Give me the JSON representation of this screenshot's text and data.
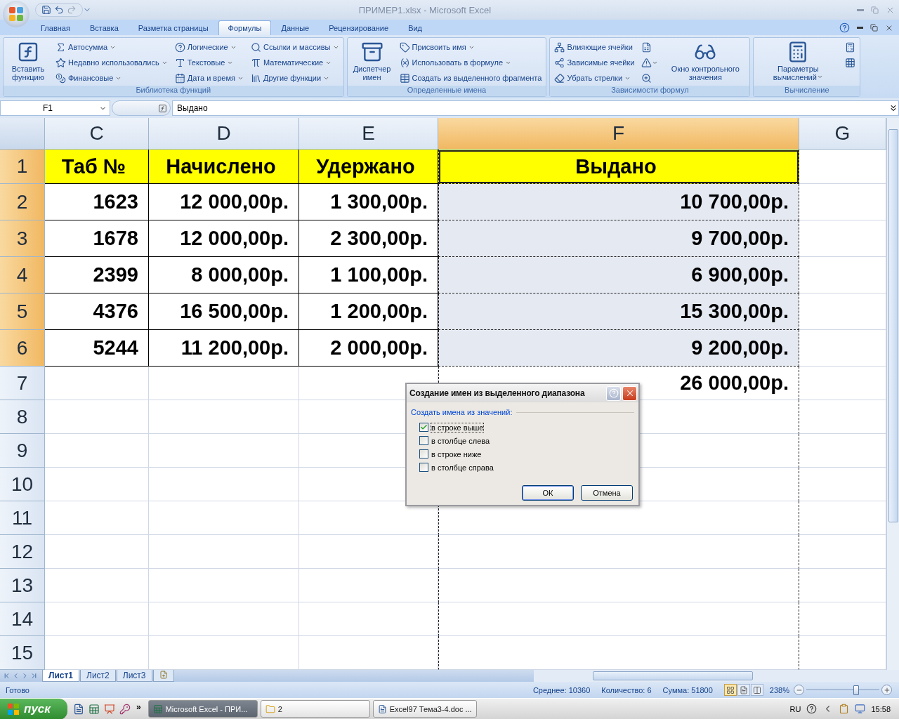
{
  "title_bar": {
    "title": "ПРИМЕР1.xlsx - Microsoft Excel"
  },
  "ribbon_tabs": [
    {
      "label": "Главная",
      "selected": false
    },
    {
      "label": "Вставка",
      "selected": false
    },
    {
      "label": "Разметка страницы",
      "selected": false
    },
    {
      "label": "Формулы",
      "selected": true
    },
    {
      "label": "Данные",
      "selected": false
    },
    {
      "label": "Рецензирование",
      "selected": false
    },
    {
      "label": "Вид",
      "selected": false
    }
  ],
  "ribbon_groups": [
    {
      "label": "Библиотека функций",
      "columns": [
        [
          {
            "kind": "large",
            "label": "Вставить функцию",
            "dropdown": false
          }
        ],
        [
          {
            "kind": "small",
            "label": "Автосумма",
            "dropdown": true
          },
          {
            "kind": "small",
            "label": "Недавно использовались",
            "dropdown": true
          },
          {
            "kind": "small",
            "label": "Финансовые",
            "dropdown": true
          }
        ],
        [
          {
            "kind": "small",
            "label": "Логические",
            "dropdown": true
          },
          {
            "kind": "small",
            "label": "Текстовые",
            "dropdown": true
          },
          {
            "kind": "small",
            "label": "Дата и время",
            "dropdown": true
          }
        ],
        [
          {
            "kind": "small",
            "label": "Ссылки и массивы",
            "dropdown": true
          },
          {
            "kind": "small",
            "label": "Математические",
            "dropdown": true
          },
          {
            "kind": "small",
            "label": "Другие функции",
            "dropdown": true
          }
        ]
      ]
    },
    {
      "label": "Определенные имена",
      "columns": [
        [
          {
            "kind": "large",
            "label": "Диспетчер имен",
            "dropdown": false
          }
        ],
        [
          {
            "kind": "small",
            "label": "Присвоить имя",
            "dropdown": true
          },
          {
            "kind": "small",
            "label": "Использовать в формуле",
            "dropdown": true
          },
          {
            "kind": "small",
            "label": "Создать из выделенного фрагмента",
            "dropdown": false
          }
        ]
      ]
    },
    {
      "label": "Зависимости формул",
      "columns": [
        [
          {
            "kind": "small",
            "label": "Влияющие ячейки",
            "dropdown": false
          },
          {
            "kind": "small",
            "label": "Зависимые ячейки",
            "dropdown": false
          },
          {
            "kind": "small",
            "label": "Убрать стрелки",
            "dropdown": true
          }
        ],
        [
          {
            "kind": "icon",
            "dropdown": false
          },
          {
            "kind": "icon",
            "dropdown": true
          },
          {
            "kind": "icon",
            "dropdown": false
          }
        ],
        [
          {
            "kind": "large",
            "label": "Окно контрольного значения",
            "dropdown": false
          }
        ]
      ]
    },
    {
      "label": "Вычисление",
      "columns": [
        [
          {
            "kind": "large",
            "label": "Параметры вычислений",
            "dropdown": true
          }
        ],
        [
          {
            "kind": "icon",
            "dropdown": false
          },
          {
            "kind": "icon",
            "dropdown": false
          }
        ]
      ]
    }
  ],
  "formula_bar": {
    "name_box": "F1",
    "formula": "Выдано"
  },
  "columns": [
    {
      "label": "C",
      "selected": false
    },
    {
      "label": "D",
      "selected": false
    },
    {
      "label": "E",
      "selected": false
    },
    {
      "label": "F",
      "selected": true
    },
    {
      "label": "G",
      "selected": false
    }
  ],
  "rows": [
    {
      "header": "1",
      "selected": true,
      "kind": "header",
      "cells": [
        {
          "text": "Таб №",
          "selected": false
        },
        {
          "text": "Начислено",
          "selected": false
        },
        {
          "text": "Удержано",
          "selected": false
        },
        {
          "text": "Выдано",
          "selected": true
        },
        null
      ]
    },
    {
      "header": "2",
      "selected": true,
      "kind": "data",
      "cells": [
        {
          "text": "1623",
          "selected": false
        },
        {
          "text": "12 000,00р.",
          "selected": false
        },
        {
          "text": "1 300,00р.",
          "selected": false
        },
        {
          "text": "10 700,00р.",
          "selected": true
        },
        null
      ]
    },
    {
      "header": "3",
      "selected": true,
      "kind": "data",
      "cells": [
        {
          "text": "1678",
          "selected": false
        },
        {
          "text": "12 000,00р.",
          "selected": false
        },
        {
          "text": "2 300,00р.",
          "selected": false
        },
        {
          "text": "9 700,00р.",
          "selected": true
        },
        null
      ]
    },
    {
      "header": "4",
      "selected": true,
      "kind": "data",
      "cells": [
        {
          "text": "2399",
          "selected": false
        },
        {
          "text": "8 000,00р.",
          "selected": false
        },
        {
          "text": "1 100,00р.",
          "selected": false
        },
        {
          "text": "6 900,00р.",
          "selected": true
        },
        null
      ]
    },
    {
      "header": "5",
      "selected": true,
      "kind": "data",
      "cells": [
        {
          "text": "4376",
          "selected": false
        },
        {
          "text": "16 500,00р.",
          "selected": false
        },
        {
          "text": "1 200,00р.",
          "selected": false
        },
        {
          "text": "15 300,00р.",
          "selected": true
        },
        null
      ]
    },
    {
      "header": "6",
      "selected": true,
      "kind": "data",
      "cells": [
        {
          "text": "5244",
          "selected": false
        },
        {
          "text": "11 200,00р.",
          "selected": false
        },
        {
          "text": "2 000,00р.",
          "selected": false
        },
        {
          "text": "9 200,00р.",
          "selected": true
        },
        null
      ]
    },
    {
      "header": "7",
      "selected": false,
      "kind": "total",
      "cells": [
        null,
        null,
        null,
        {
          "text": "26 000,00р.",
          "selected": false
        },
        null
      ]
    },
    {
      "header": "8",
      "selected": false,
      "kind": "blank"
    },
    {
      "header": "9",
      "selected": false,
      "kind": "blank"
    },
    {
      "header": "10",
      "selected": false,
      "kind": "blank"
    },
    {
      "header": "11",
      "selected": false,
      "kind": "blank"
    },
    {
      "header": "12",
      "selected": false,
      "kind": "blank"
    },
    {
      "header": "13",
      "selected": false,
      "kind": "blank"
    },
    {
      "header": "14",
      "selected": false,
      "kind": "blank"
    },
    {
      "header": "15",
      "selected": false,
      "kind": "blank"
    }
  ],
  "dialog": {
    "title": "Создание имен из выделенного диапазона",
    "group_label": "Создать имена из значений:",
    "options": [
      {
        "label": "в строке выше",
        "checked": true
      },
      {
        "label": "в столбце слева",
        "checked": false
      },
      {
        "label": "в строке ниже",
        "checked": false
      },
      {
        "label": "в столбце справа",
        "checked": false
      }
    ],
    "buttons": [
      "ОК",
      "Отмена"
    ]
  },
  "sheet_tabs": [
    {
      "label": "Лист1",
      "selected": true
    },
    {
      "label": "Лист2",
      "selected": false
    },
    {
      "label": "Лист3",
      "selected": false
    }
  ],
  "status_bar": {
    "status": "Готово",
    "stats": [
      "Среднее: 10360",
      "Количество: 6",
      "Сумма: 51800"
    ],
    "views": [
      {
        "selected": true
      },
      {
        "selected": false
      },
      {
        "selected": false
      }
    ],
    "zoom": "238%",
    "zoom_slider": {
      "level": 0.68
    }
  },
  "taskbar": {
    "start": "пуск",
    "more": "»",
    "tasks": [
      {
        "label": "Microsoft Excel - ПРИ...",
        "selected": true
      },
      {
        "label": "2",
        "selected": false
      },
      {
        "label": "Excel97 Тема3-4.doc ...",
        "selected": false
      }
    ],
    "language": "RU",
    "clock": "15:58"
  }
}
